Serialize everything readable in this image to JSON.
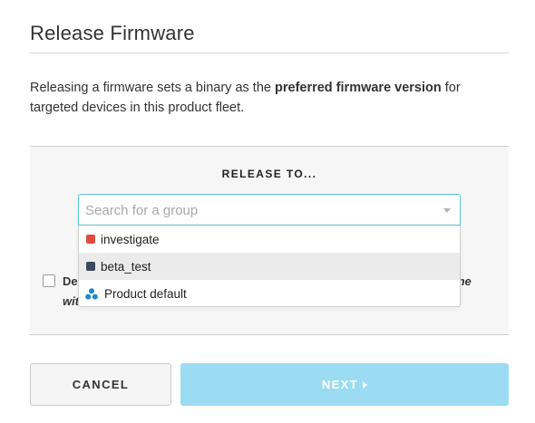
{
  "modal": {
    "title": "Release Firmware",
    "intro_before": "Releasing a firmware sets a binary as the ",
    "intro_bold": "preferred firmware version",
    "intro_after": " for targeted devices in this product fleet."
  },
  "release": {
    "heading": "RELEASE TO...",
    "search_placeholder": "Search for a group",
    "options": [
      {
        "label": "investigate",
        "color": "#e04b3f"
      },
      {
        "label": "beta_test",
        "color": "#3b4a5c"
      },
      {
        "label": "Product default",
        "icon": "fleet-icon",
        "color": "#1e88c8"
      }
    ],
    "checkbox_label_start": "De",
    "checkbox_label_line2": "wit",
    "checkbox_label_tail": "ine"
  },
  "footer": {
    "cancel_label": "CANCEL",
    "next_label": "NEXT"
  },
  "colors": {
    "accent_border": "#57c4d0",
    "next_button": "#9bdcf3"
  }
}
